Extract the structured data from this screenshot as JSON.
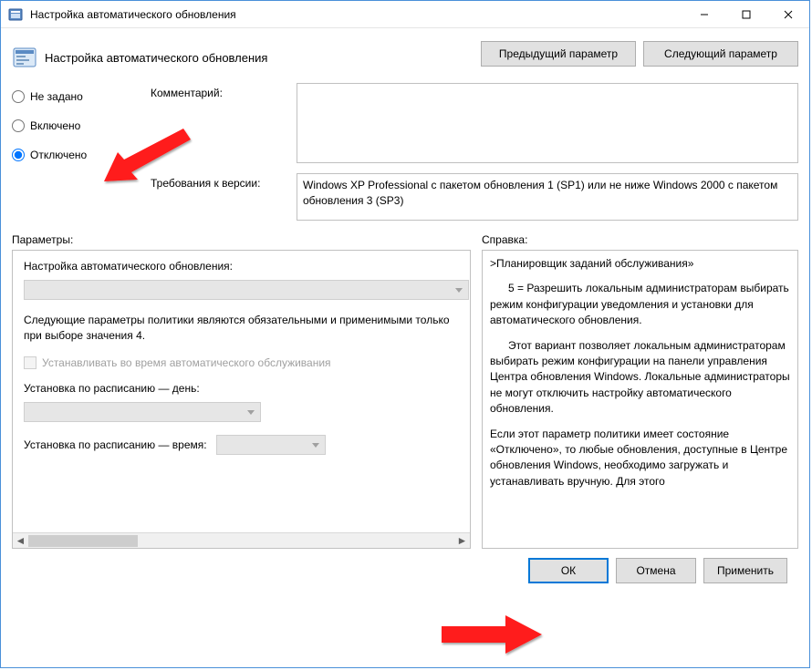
{
  "window": {
    "title": "Настройка автоматического обновления"
  },
  "header": {
    "policy_title": "Настройка автоматического обновления",
    "prev_button": "Предыдущий параметр",
    "next_button": "Следующий параметр"
  },
  "radios": {
    "not_configured": "Не задано",
    "enabled": "Включено",
    "disabled": "Отключено",
    "selected": "disabled"
  },
  "fields": {
    "comment_label": "Комментарий:",
    "comment_value": "",
    "supported_label": "Требования к версии:",
    "supported_value": "Windows XP Professional с пакетом обновления 1 (SP1) или не ниже Windows 2000 с пакетом обновления 3 (SP3)"
  },
  "labels": {
    "options": "Параметры:",
    "help": "Справка:"
  },
  "options": {
    "configure_label": "Настройка автоматического обновления:",
    "note": "Следующие параметры политики являются обязательными и применимыми только при выборе значения 4.",
    "maintenance_checkbox": "Устанавливать во время автоматического обслуживания",
    "schedule_day_label": "Установка по расписанию — день:",
    "schedule_time_label": "Установка по расписанию — время:"
  },
  "help": {
    "p1": ">Планировщик заданий обслуживания»",
    "p2": "      5 = Разрешить локальным администраторам выбирать режим конфигурации уведомления и установки для автоматического обновления.",
    "p3": "      Этот вариант позволяет локальным администраторам выбирать режим конфигурации на панели управления Центра обновления Windows. Локальные администраторы не могут отключить настройку автоматического обновления.",
    "p4": "Если этот параметр политики имеет состояние «Отключено», то любые обновления, доступные в Центре обновления Windows, необходимо загружать и устанавливать вручную. Для этого"
  },
  "footer": {
    "ok": "ОК",
    "cancel": "Отмена",
    "apply": "Применить"
  }
}
